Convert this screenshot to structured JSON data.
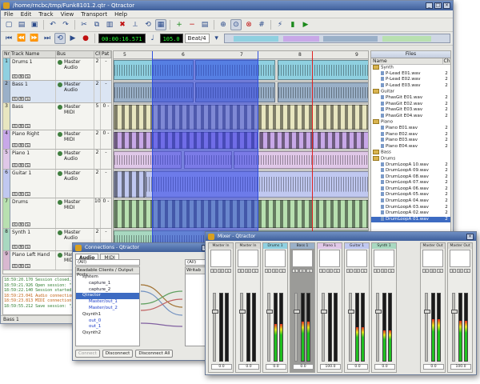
{
  "app": {
    "title": "/home/rncbc/tmp/Funk8101.2.qtr - Qtractor"
  },
  "menu": [
    "File",
    "Edit",
    "Track",
    "View",
    "Transport",
    "Help"
  ],
  "toolbar": {
    "time_display": "00:00:16.571",
    "tempo_display": "105.0",
    "snap": "Beat/4"
  },
  "tracklist": {
    "headers": {
      "nr": "Nr",
      "name": "Track Name",
      "bus": "Bus",
      "ch": "Ch",
      "pat": "Pat"
    },
    "tracks": [
      {
        "nr": "1",
        "name": "Drums 1",
        "bus": "Master",
        "bus2": "Audio",
        "ch": "2",
        "pat": "-"
      },
      {
        "nr": "2",
        "name": "Bass 1",
        "bus": "Master",
        "bus2": "Audio",
        "ch": "2",
        "pat": "-"
      },
      {
        "nr": "3",
        "name": "Bass",
        "bus": "Master",
        "bus2": "MIDI",
        "ch": "5",
        "pat": "0 -"
      },
      {
        "nr": "4",
        "name": "Piano Right",
        "bus": "Master",
        "bus2": "MIDI",
        "ch": "2",
        "pat": "0 -"
      },
      {
        "nr": "5",
        "name": "Piano 1",
        "bus": "Master",
        "bus2": "Audio",
        "ch": "2",
        "pat": "-"
      },
      {
        "nr": "6",
        "name": "Guitar 1",
        "bus": "Master",
        "bus2": "Audio",
        "ch": "2",
        "pat": "-"
      },
      {
        "nr": "7",
        "name": "Drums",
        "bus": "Master",
        "bus2": "MIDI",
        "ch": "10",
        "pat": "0 -"
      },
      {
        "nr": "8",
        "name": "Synth 1",
        "bus": "Master",
        "bus2": "Audio",
        "ch": "2",
        "pat": "-"
      },
      {
        "nr": "9",
        "name": "Piano Left Hand",
        "bus": "Master",
        "bus2": "MIDI",
        "ch": "2",
        "pat": "0 -"
      }
    ]
  },
  "ruler": [
    "5",
    "6",
    "7",
    "8",
    "9"
  ],
  "colors": {
    "drums1": "#8fd0e0",
    "bass1": "#9ab0c8",
    "bass": "#e8e6c0",
    "piano_right": "#c8a8e8",
    "piano1": "#e0c8e8",
    "guitar1": "#c0c8f0",
    "drums": "#b8e0b0",
    "synth1": "#a8d8c0",
    "piano_left": "#d8b8d0",
    "selection": "#2838e6",
    "playhead": "#e02020",
    "loop": "#3050e0"
  },
  "files": {
    "title": "Files",
    "headers": {
      "name": "Name",
      "ch": "Ch"
    },
    "rows": [
      {
        "kind": "grp",
        "name": "Synth",
        "ch": ""
      },
      {
        "kind": "item",
        "name": "P-Lead E01.wav",
        "ch": "2"
      },
      {
        "kind": "item",
        "name": "P-Lead E02.wav",
        "ch": "2"
      },
      {
        "kind": "item",
        "name": "P-Lead E03.wav",
        "ch": "2"
      },
      {
        "kind": "grp",
        "name": "Guitar",
        "ch": ""
      },
      {
        "kind": "item",
        "name": "PhasGit E01.wav",
        "ch": "2"
      },
      {
        "kind": "item",
        "name": "PhasGit E02.wav",
        "ch": "2"
      },
      {
        "kind": "item",
        "name": "PhasGit E03.wav",
        "ch": "2"
      },
      {
        "kind": "item",
        "name": "PhasGit E04.wav",
        "ch": "2"
      },
      {
        "kind": "grp",
        "name": "Piano",
        "ch": ""
      },
      {
        "kind": "item",
        "name": "Piano E01.wav",
        "ch": "2"
      },
      {
        "kind": "item",
        "name": "Piano E02.wav",
        "ch": "2"
      },
      {
        "kind": "item",
        "name": "Piano E03.wav",
        "ch": "2"
      },
      {
        "kind": "item",
        "name": "Piano E04.wav",
        "ch": "2"
      },
      {
        "kind": "grp",
        "name": "Bass",
        "ch": ""
      },
      {
        "kind": "grp",
        "name": "Drums",
        "ch": ""
      },
      {
        "kind": "item",
        "name": "DrumLoopA 10.wav",
        "ch": "2"
      },
      {
        "kind": "item",
        "name": "DrumLoopA 09.wav",
        "ch": "2"
      },
      {
        "kind": "item",
        "name": "DrumLoopA 08.wav",
        "ch": "2"
      },
      {
        "kind": "item",
        "name": "DrumLoopA 07.wav",
        "ch": "2"
      },
      {
        "kind": "item",
        "name": "DrumLoopA 06.wav",
        "ch": "2"
      },
      {
        "kind": "item",
        "name": "DrumLoopA 05.wav",
        "ch": "2"
      },
      {
        "kind": "item",
        "name": "DrumLoopA 04.wav",
        "ch": "2"
      },
      {
        "kind": "item",
        "name": "DrumLoopA 03.wav",
        "ch": "2"
      },
      {
        "kind": "item",
        "name": "DrumLoopA 02.wav",
        "ch": "2"
      },
      {
        "kind": "item",
        "name": "DrumLoopA 01.wav",
        "ch": "2",
        "selected": true
      }
    ]
  },
  "messages": [
    "18:59:20.170 Session closed.",
    "18:59:21.926 Open session: \"",
    "18:59:22.140 Session started.",
    "18:59:23.041 Audio connection",
    "18:59:23.813 MIDI connection",
    "18:59:55.212 Save session: \"/"
  ],
  "status": "Bass 1",
  "connections": {
    "title": "Connections - Qtractor",
    "tabs": [
      "Audio",
      "MIDI"
    ],
    "left_select": "(All)",
    "right_select": "(All)",
    "left_header": "Readable Clients / Output Ports",
    "right_header": "Writab",
    "ports": [
      {
        "lvl": 0,
        "name": "system"
      },
      {
        "lvl": 1,
        "name": "capture_1"
      },
      {
        "lvl": 1,
        "name": "capture_2"
      },
      {
        "lvl": 0,
        "name": "Qtractor",
        "selected": true
      },
      {
        "lvl": 1,
        "name": "Master/out_1",
        "blue": true
      },
      {
        "lvl": 1,
        "name": "Master/out_2",
        "blue": true
      },
      {
        "lvl": 0,
        "name": "Qsynth1"
      },
      {
        "lvl": 1,
        "name": "out_0",
        "blue": true
      },
      {
        "lvl": 1,
        "name": "out_1",
        "blue": true
      },
      {
        "lvl": 0,
        "name": "Qsynth2"
      }
    ],
    "buttons": {
      "connect": "Connect",
      "disconnect": "Disconnect",
      "disconnect_all": "Disconnect All"
    }
  },
  "mixer": {
    "title": "Mixer - Qtractor",
    "strips": [
      {
        "name": "Master In",
        "value": "0.0",
        "level": 0.0,
        "head": "#d8d8d4"
      },
      {
        "name": "Master In",
        "value": "0.0",
        "level": 0.0,
        "head": "#d8d8d4"
      },
      {
        "name": "Drums 1",
        "value": "0.0",
        "level": 0.55,
        "head": "#8fd0e0"
      },
      {
        "name": "Bass 1",
        "value": "0.0",
        "level": 0.58,
        "head": "#9ab0c8",
        "selected": true
      },
      {
        "name": "Piano 1",
        "value": "100.0",
        "level": 0.0,
        "head": "#e0c8e8"
      },
      {
        "name": "Guitar 1",
        "value": "0.0",
        "level": 0.5,
        "head": "#c0c8f0"
      },
      {
        "name": "Synth 1",
        "value": "0.0",
        "level": 0.45,
        "head": "#a8d8c0"
      },
      {
        "name": "Master Out",
        "value": "0.0",
        "level": 0.62,
        "head": "#d8d8d4"
      },
      {
        "name": "Master Out",
        "value": "100.0",
        "level": 0.6,
        "head": "#d8d8d4"
      }
    ]
  }
}
